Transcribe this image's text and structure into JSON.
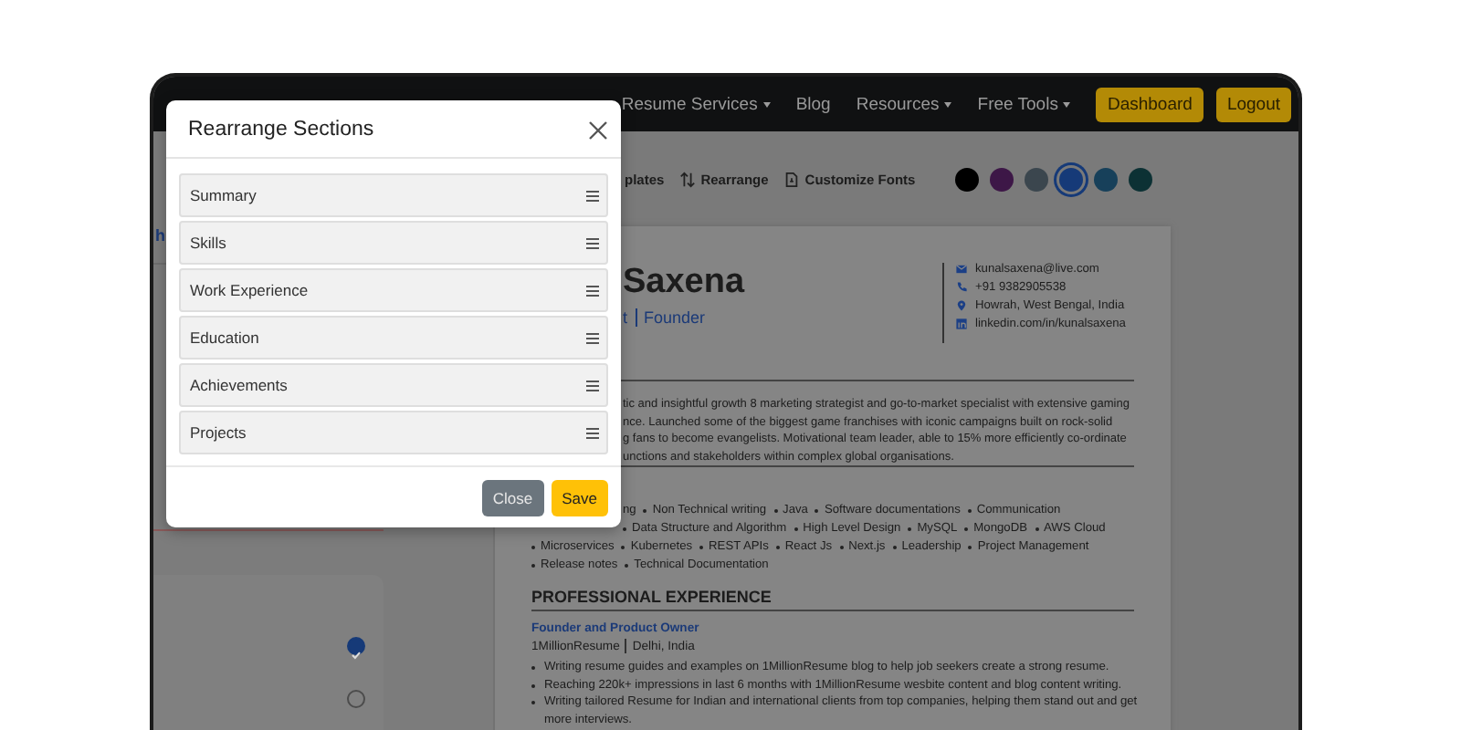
{
  "navbar": {
    "items": [
      {
        "label": "Resume Services",
        "dropdown": true
      },
      {
        "label": "Blog",
        "dropdown": false
      },
      {
        "label": "Resources",
        "dropdown": true
      },
      {
        "label": "Free Tools",
        "dropdown": true
      }
    ],
    "buttons": [
      "Dashboard",
      "Logout"
    ]
  },
  "toolbar": {
    "items": [
      {
        "label": "plates",
        "kind": "plain"
      },
      {
        "label": "Rearrange",
        "kind": "rearrange"
      },
      {
        "label": "Customize Fonts",
        "kind": "fonts"
      }
    ],
    "swatches": [
      {
        "color": "#000000",
        "selected": false
      },
      {
        "color": "#3d1747",
        "selected": false
      },
      {
        "color": "#3b464e",
        "selected": false
      },
      {
        "color": "#163a78",
        "selected": true
      },
      {
        "color": "#17405a",
        "selected": false
      },
      {
        "color": "#0c3134",
        "selected": false
      }
    ]
  },
  "sidebar": {
    "link": "h",
    "options": [
      {
        "selected": true
      },
      {
        "selected": false
      }
    ]
  },
  "resume": {
    "name": "Saxena",
    "title_parts": [
      "t",
      "Founder"
    ],
    "contacts": [
      {
        "kind": "email",
        "text": "kunalsaxena@live.com"
      },
      {
        "kind": "phone",
        "text": "+91 9382905538"
      },
      {
        "kind": "location",
        "text": "Howrah, West Bengal, India"
      },
      {
        "kind": "linkedin",
        "text": "linkedin.com/in/kunalsaxena"
      }
    ],
    "summary_lines": [
      "tic and insightful growth 8 marketing strategist and go-to-market specialist with extensive gaming",
      "nce. Launched some of the biggest game franchises with iconic campaigns built on rock-solid",
      "g fans to become evangelists. Motivational team leader, able to 15% more efficiently co-ordinate",
      "unctions and stakeholders within complex global organisations."
    ],
    "skill_rows": [
      {
        "lead": "ng",
        "items": [
          "Non Technical writing",
          "Java",
          "Software documentations",
          "Communication"
        ]
      },
      {
        "lead": "",
        "items": [
          "Data Structure and Algorithm",
          "High Level Design",
          "MySQL",
          "MongoDB",
          "AWS Cloud"
        ]
      },
      {
        "lead": "",
        "items": [
          "Microservices",
          "Kubernetes",
          "REST APIs",
          "React Js",
          "Next.js",
          "Leadership",
          "Project Management"
        ]
      },
      {
        "lead": "",
        "items": [
          "Release notes",
          "Technical Documentation"
        ]
      }
    ],
    "experience_heading": "PROFESSIONAL EXPERIENCE",
    "job": {
      "role": "Founder and Product Owner",
      "company": "1MillionResume",
      "place": "Delhi, India",
      "bullets": [
        "Writing resume guides and examples on 1MillionResume blog to help job seekers create a strong resume.",
        "Reaching 220k+ impressions in last 6 months with 1MillionResume wesbite content and blog content writing.",
        "Writing tailored Resume for Indian and international clients from top companies, helping them stand out and get more interviews."
      ]
    }
  },
  "modal": {
    "title": "Rearrange Sections",
    "sections": [
      "Summary",
      "Skills",
      "Work Experience",
      "Education",
      "Achievements",
      "Projects"
    ],
    "buttons": [
      {
        "label": "Close",
        "kind": "secondary"
      },
      {
        "label": "Save",
        "kind": "primary"
      }
    ]
  }
}
